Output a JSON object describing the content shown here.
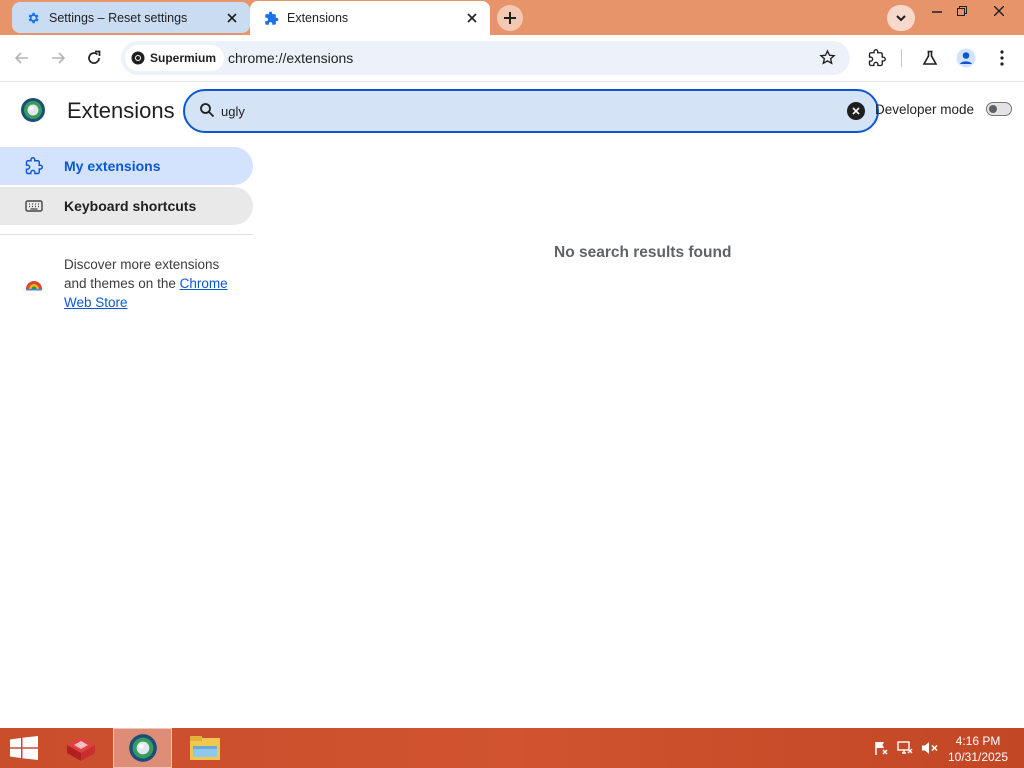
{
  "tabs": [
    {
      "title": "Settings – Reset settings",
      "icon": "gear-icon",
      "active": false
    },
    {
      "title": "Extensions",
      "icon": "puzzle-icon",
      "active": true
    }
  ],
  "toolbar": {
    "site_chip": "Supermium",
    "url": "chrome://extensions"
  },
  "header": {
    "title": "Extensions",
    "search_value": "ugly",
    "developer_mode_label": "Developer mode",
    "developer_mode_on": false
  },
  "sidebar": {
    "items": [
      {
        "label": "My extensions",
        "icon": "extensions-icon",
        "selected": true
      },
      {
        "label": "Keyboard shortcuts",
        "icon": "keyboard-icon",
        "selected": false
      }
    ],
    "discover_text": "Discover more extensions and themes on the ",
    "discover_link": "Chrome Web Store"
  },
  "main": {
    "no_results": "No search results found"
  },
  "taskbar": {
    "time": "4:16 PM",
    "date": "10/31/2025"
  },
  "colors": {
    "accent": "#0b57d0",
    "titlebar": "#e8946b",
    "taskbar": "#d1532f"
  }
}
